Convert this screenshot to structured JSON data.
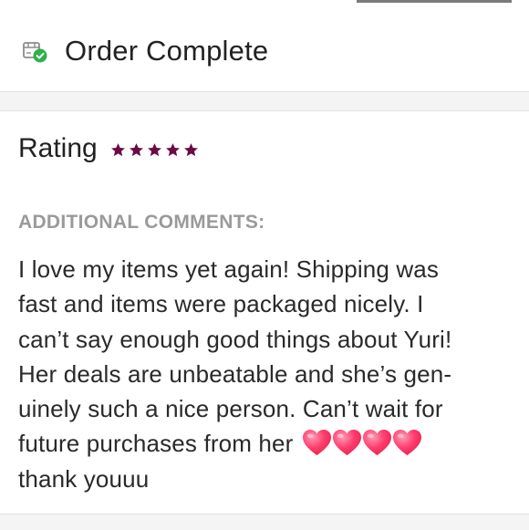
{
  "status": {
    "title": "Order Complete",
    "icon": "package-check-icon",
    "icon_color": "#2fb04a"
  },
  "rating": {
    "label": "Rating",
    "stars": 5,
    "max_stars": 5,
    "star_color": "#6b0b43"
  },
  "comments": {
    "label": "ADDITIONAL COMMENTS:",
    "lines": [
      "I love my items yet again! Shipping was",
      "fast and items were packaged nicely. I",
      "can’t say enough good things about Yuri!",
      "Her deals are unbeatable and she’s gen-",
      "uinely such a nice person. Can’t wait for",
      "future purchases from her",
      "thank youuu"
    ],
    "heart_emoji": "pink-heart-icon",
    "heart_count": 4,
    "heart_color": "#ff3d6e"
  }
}
